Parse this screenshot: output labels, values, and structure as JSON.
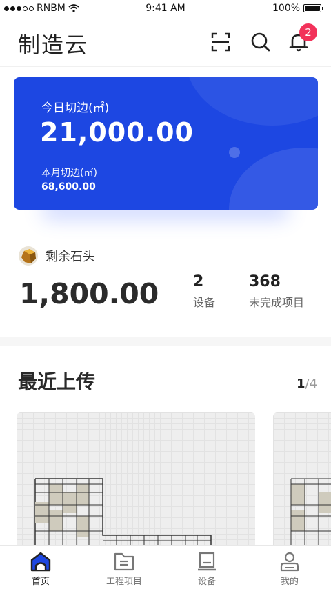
{
  "status_bar": {
    "carrier": "RNBM",
    "time": "9:41 AM",
    "battery": "100%"
  },
  "header": {
    "title": "制造云",
    "notification_count": "2"
  },
  "summary_card": {
    "today_label": "今日切边(㎡)",
    "today_value": "21,000.00",
    "month_label": "本月切边(㎡)",
    "month_value": "68,600.00",
    "color": "#1d47e2"
  },
  "stone": {
    "label": "剩余石头",
    "value": "1,800.00",
    "stats": [
      {
        "value": "2",
        "label": "设备"
      },
      {
        "value": "368",
        "label": "未完成项目"
      }
    ]
  },
  "recent": {
    "title": "最近上传",
    "page_current": "1",
    "page_total": "/4"
  },
  "tabs": [
    {
      "label": "首页",
      "icon": "home-icon",
      "active": true
    },
    {
      "label": "工程项目",
      "icon": "folder-icon",
      "active": false
    },
    {
      "label": "设备",
      "icon": "machine-icon",
      "active": false
    },
    {
      "label": "我的",
      "icon": "profile-icon",
      "active": false
    }
  ],
  "colors": {
    "accent": "#1d47e2",
    "badge": "#f2325a"
  }
}
